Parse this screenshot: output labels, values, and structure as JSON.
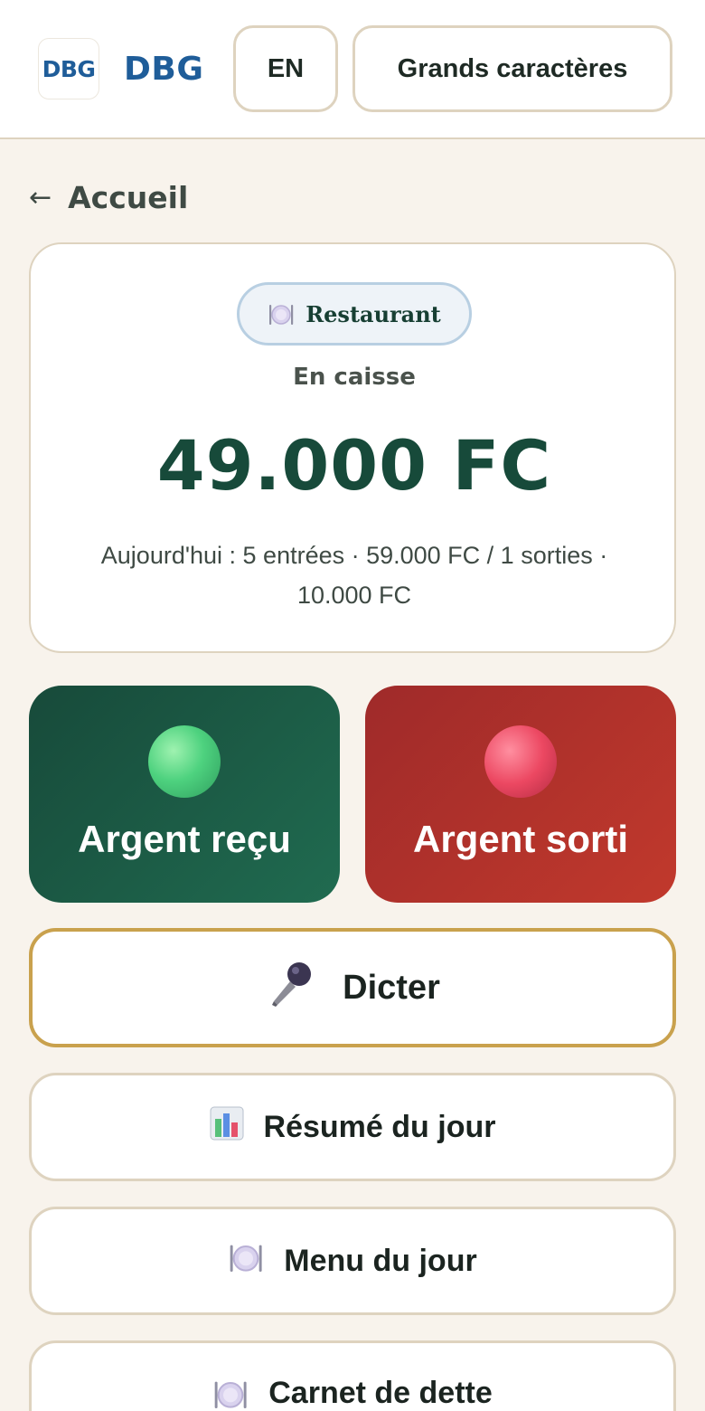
{
  "header": {
    "logo_tile_text": "DBG",
    "brand_text": "DBG",
    "language_button": "EN",
    "large_text_button": "Grands caractères"
  },
  "nav": {
    "back_arrow": "←",
    "back_label": "Accueil"
  },
  "balance": {
    "business_type": "Restaurant",
    "business_icon": "plate-cutlery-icon",
    "caption": "En caisse",
    "amount": "49.000 FC",
    "today_summary": "Aujourd'hui : 5 entrées · 59.000 FC / 1 sorties · 10.000 FC"
  },
  "actions": {
    "money_in_label": "Argent reçu",
    "money_out_label": "Argent sorti"
  },
  "menu": {
    "dictate_label": "Dicter",
    "summary_label": "Résumé du jour",
    "daily_menu_label": "Menu du jour",
    "debt_book_label": "Carnet de dette"
  },
  "colors": {
    "brand_blue": "#1f5d99",
    "primary_green": "#174a3a",
    "danger_red": "#b3312b",
    "accent_gold": "#c9a14d",
    "background": "#f8f3ec"
  }
}
